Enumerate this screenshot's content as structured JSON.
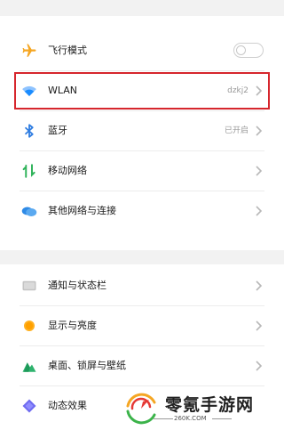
{
  "colors": {
    "airplane": "#f5a623",
    "wlan": "#1a8cff",
    "bluetooth": "#2f7de1",
    "mobile": "#2fb35a",
    "other_network": "#2e8ae6",
    "highlight": "#d6262d"
  },
  "settings_group_1": {
    "items": [
      {
        "label": "飞行模式",
        "icon": "airplane-icon",
        "control": "toggle",
        "toggle_on": false
      },
      {
        "label": "WLAN",
        "icon": "wifi-icon",
        "value": "dzkj2"
      },
      {
        "label": "蓝牙",
        "icon": "bluetooth-icon",
        "value": "已开启"
      },
      {
        "label": "移动网络",
        "icon": "mobile-data-icon"
      },
      {
        "label": "其他网络与连接",
        "icon": "cloud-icon"
      }
    ]
  },
  "settings_group_2": {
    "items": [
      {
        "label": "通知与状态栏",
        "icon": "notification-icon"
      },
      {
        "label": "显示与亮度",
        "icon": "brightness-icon"
      },
      {
        "label": "桌面、锁屏与壁纸",
        "icon": "wallpaper-icon"
      },
      {
        "label": "动态效果",
        "icon": "motion-effects-icon"
      }
    ]
  },
  "watermark": {
    "title": "零氪手游网",
    "subtitle": "260K.COM"
  }
}
